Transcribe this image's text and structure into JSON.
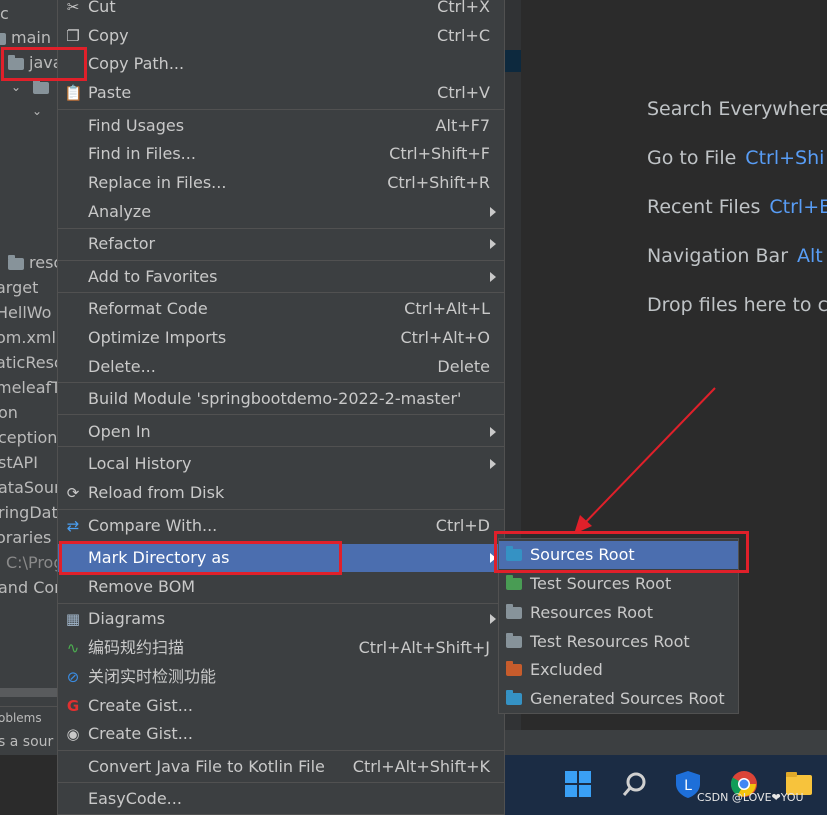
{
  "project_tree": {
    "items": [
      "c",
      "main",
      "java",
      "resc",
      "arget",
      "HellWo",
      "om.xml",
      "aticResc",
      "meleafT",
      "on",
      "ception",
      "stAPI",
      "ataSourc",
      "ringDat",
      "oraries",
      "C:\\Prog",
      "and Con"
    ]
  },
  "problems_tab": "oblems",
  "status_text": "s a sour",
  "editor_hints": [
    {
      "label": "Search Everywhere",
      "key": ""
    },
    {
      "label": "Go to File",
      "key": "Ctrl+Shi"
    },
    {
      "label": "Recent Files",
      "key": "Ctrl+E"
    },
    {
      "label": "Navigation Bar",
      "key": "Alt"
    },
    {
      "label": "Drop files here to c",
      "key": ""
    }
  ],
  "context_menu": {
    "items": [
      {
        "label": "Cut",
        "shortcut": "Ctrl+X",
        "icon": "scissors-icon"
      },
      {
        "label": "Copy",
        "shortcut": "Ctrl+C",
        "icon": "copy-icon"
      },
      {
        "label": "Copy Path...",
        "shortcut": "",
        "icon": ""
      },
      {
        "label": "Paste",
        "shortcut": "Ctrl+V",
        "icon": "clipboard-icon"
      },
      {
        "label": "Find Usages",
        "shortcut": "Alt+F7",
        "icon": ""
      },
      {
        "label": "Find in Files...",
        "shortcut": "Ctrl+Shift+F",
        "icon": ""
      },
      {
        "label": "Replace in Files...",
        "shortcut": "Ctrl+Shift+R",
        "icon": ""
      },
      {
        "label": "Analyze",
        "shortcut": "",
        "icon": "",
        "submenu": true
      },
      {
        "label": "Refactor",
        "shortcut": "",
        "icon": "",
        "submenu": true
      },
      {
        "label": "Add to Favorites",
        "shortcut": "",
        "icon": "",
        "submenu": true
      },
      {
        "label": "Reformat Code",
        "shortcut": "Ctrl+Alt+L",
        "icon": ""
      },
      {
        "label": "Optimize Imports",
        "shortcut": "Ctrl+Alt+O",
        "icon": ""
      },
      {
        "label": "Delete...",
        "shortcut": "Delete",
        "icon": ""
      },
      {
        "label": "Build Module 'springbootdemo-2022-2-master'",
        "shortcut": "",
        "icon": ""
      },
      {
        "label": "Open In",
        "shortcut": "",
        "icon": "",
        "submenu": true
      },
      {
        "label": "Local History",
        "shortcut": "",
        "icon": "",
        "submenu": true
      },
      {
        "label": "Reload from Disk",
        "shortcut": "",
        "icon": "reload-icon"
      },
      {
        "label": "Compare With...",
        "shortcut": "Ctrl+D",
        "icon": "compare-icon"
      },
      {
        "label": "Mark Directory as",
        "shortcut": "",
        "icon": "",
        "submenu": true,
        "selected": true
      },
      {
        "label": "Remove BOM",
        "shortcut": "",
        "icon": ""
      },
      {
        "label": "Diagrams",
        "shortcut": "",
        "icon": "diagram-icon",
        "submenu": true
      },
      {
        "label": "编码规约扫描",
        "shortcut": "Ctrl+Alt+Shift+J",
        "icon": "scan-icon"
      },
      {
        "label": "关闭实时检测功能",
        "shortcut": "",
        "icon": "disable-icon"
      },
      {
        "label": "Create Gist...",
        "shortcut": "",
        "icon": "gist-icon"
      },
      {
        "label": "Create Gist...",
        "shortcut": "",
        "icon": "github-icon"
      },
      {
        "label": "Convert Java File to Kotlin File",
        "shortcut": "Ctrl+Alt+Shift+K",
        "icon": ""
      },
      {
        "label": "EasyCode...",
        "shortcut": "",
        "icon": ""
      }
    ]
  },
  "submenu": {
    "items": [
      {
        "label": "Sources Root",
        "icon": "sources-root-folder-icon",
        "color": "#3592c4",
        "selected": true
      },
      {
        "label": "Test Sources Root",
        "icon": "test-sources-root-folder-icon",
        "color": "#499c54"
      },
      {
        "label": "Resources Root",
        "icon": "resources-root-folder-icon",
        "color": "#87939a"
      },
      {
        "label": "Test Resources Root",
        "icon": "test-resources-root-folder-icon",
        "color": "#87939a"
      },
      {
        "label": "Excluded",
        "icon": "excluded-folder-icon",
        "color": "#c75c2c"
      },
      {
        "label": "Generated Sources Root",
        "icon": "generated-sources-root-folder-icon",
        "color": "#3592c4"
      }
    ]
  },
  "watermark": "CSDN @LOVE❤YOU",
  "colors": {
    "highlight": "#4b6eaf",
    "annotation_red": "#e0202a",
    "link_blue": "#589df6"
  }
}
